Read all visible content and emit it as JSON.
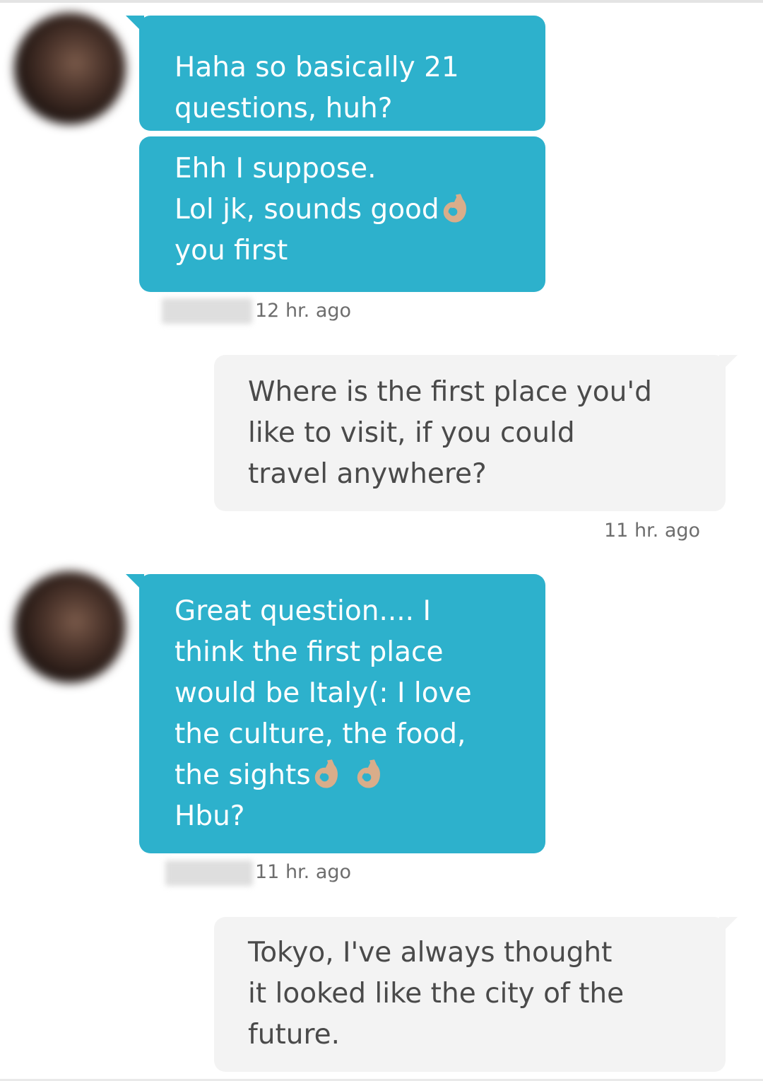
{
  "messages": [
    {
      "sender": "them",
      "bubbles": [
        {
          "lines": [
            "Haha so basically 21",
            "questions, huh?"
          ]
        },
        {
          "lines": [
            "Ehh I suppose.",
            "Lol jk, sounds good",
            "you first"
          ]
        }
      ],
      "timestamp": "12 hr. ago"
    },
    {
      "sender": "me",
      "lines": [
        "Where is the first place you'd",
        "like to visit, if you could",
        "travel anywhere?"
      ],
      "timestamp": "11 hr. ago"
    },
    {
      "sender": "them",
      "lines": [
        "Great question.... I",
        "think the first place",
        "would be Italy(: I love",
        "the culture, the food,",
        "the sights",
        "Hbu?"
      ],
      "timestamp": "11 hr. ago"
    },
    {
      "sender": "me",
      "lines": [
        "Tokyo, I've always thought",
        "it looked like the city of the",
        "future."
      ]
    }
  ],
  "emoji": {
    "name": "ok-hand-emoji",
    "skin_color": "#d9ad8a",
    "outline_color": "#b98a66"
  },
  "colors": {
    "incoming_bubble": "#2db1cc",
    "outgoing_bubble": "#f3f3f3",
    "timestamp": "#6d6d6d"
  }
}
